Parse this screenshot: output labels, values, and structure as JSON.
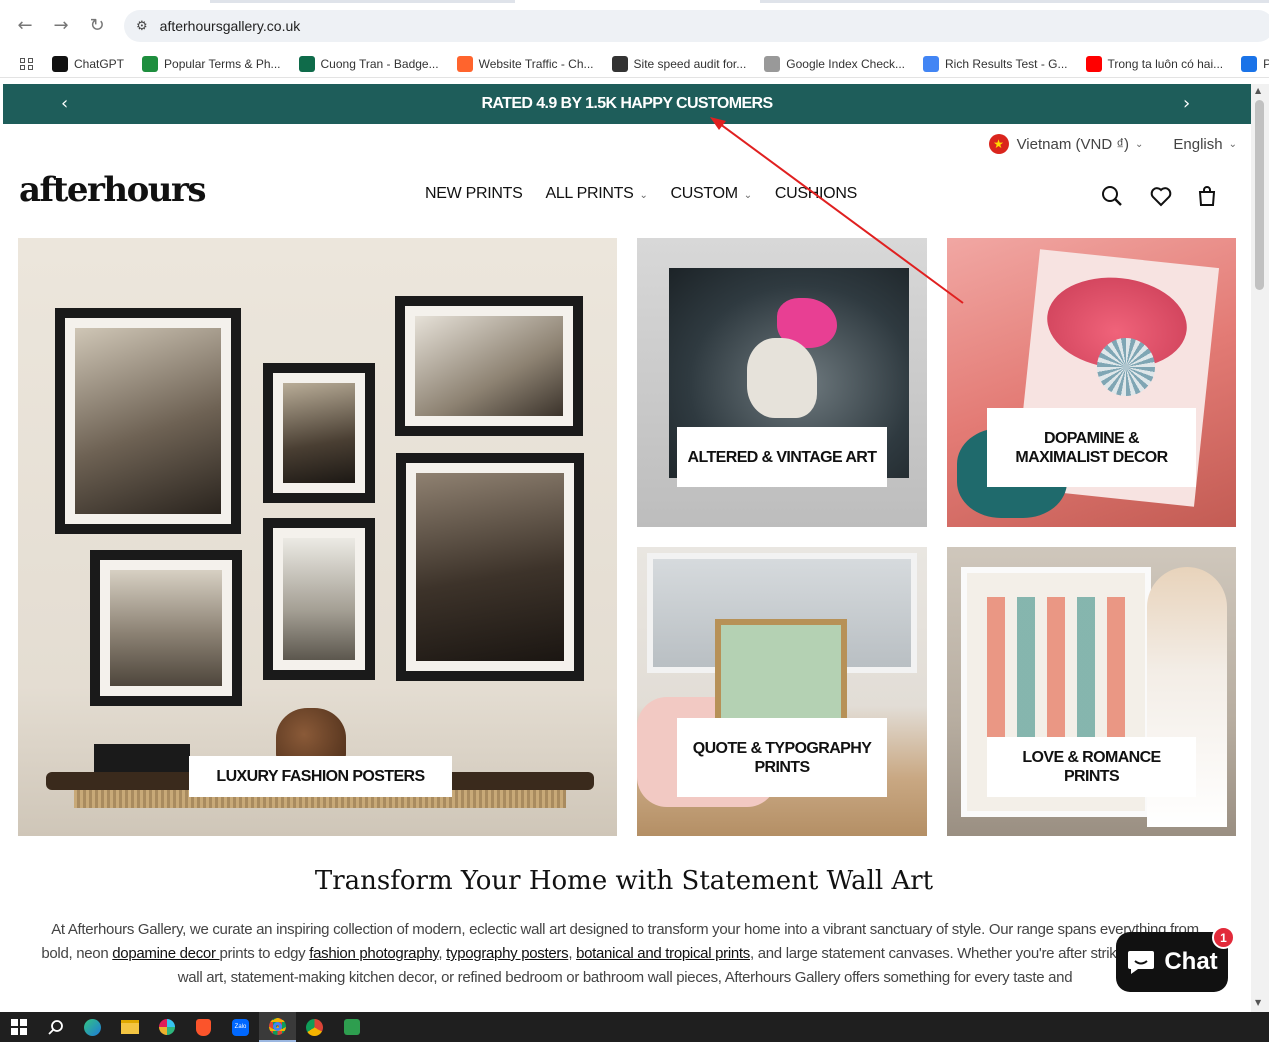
{
  "browser": {
    "url": "afterhoursgallery.co.uk",
    "bookmarks": [
      {
        "label": "ChatGPT",
        "icon": "chatgpt-icon",
        "color": "#111111"
      },
      {
        "label": "Popular Terms & Ph...",
        "icon": "sheets-icon",
        "color": "#1e8e3e"
      },
      {
        "label": "Cuong Tran - Badge...",
        "icon": "c-badge-icon",
        "color": "#0f6b4a"
      },
      {
        "label": "Website Traffic - Ch...",
        "icon": "semrush-icon",
        "color": "#ff642d"
      },
      {
        "label": "Site speed audit for...",
        "icon": "document-icon",
        "color": "#333333"
      },
      {
        "label": "Google Index Check...",
        "icon": "sst-icon",
        "color": "#999999"
      },
      {
        "label": "Rich Results Test - G...",
        "icon": "rich-results-icon",
        "color": "#4285f4"
      },
      {
        "label": "Trong ta luôn có hai...",
        "icon": "youtube-icon",
        "color": "#ff0000"
      },
      {
        "label": "Pag",
        "icon": "pagespeed-icon",
        "color": "#1a73e8"
      }
    ]
  },
  "announcement": {
    "text": "RATED 4.9 BY 1.5K HAPPY CUSTOMERS",
    "bg_color": "#1e5d5a"
  },
  "locale": {
    "country": "Vietnam (VND ₫)",
    "language": "English"
  },
  "header": {
    "logo": "afterhours",
    "nav": [
      {
        "label": "NEW PRINTS",
        "has_dropdown": false
      },
      {
        "label": "ALL PRINTS",
        "has_dropdown": true
      },
      {
        "label": "CUSTOM",
        "has_dropdown": true
      },
      {
        "label": "CUSHIONS",
        "has_dropdown": false
      }
    ]
  },
  "collections": [
    {
      "label": "LUXURY FASHION POSTERS"
    },
    {
      "label": "ALTERED & VINTAGE ART"
    },
    {
      "label": "DOPAMINE & MAXIMALIST DECOR"
    },
    {
      "label": "QUOTE & TYPOGRAPHY PRINTS"
    },
    {
      "label": "LOVE & ROMANCE PRINTS"
    }
  ],
  "section": {
    "heading": "Transform Your Home with Statement Wall Art",
    "p1": "At Afterhours Gallery, we curate an inspiring collection of modern, eclectic wall art designed to transform your home into a vibrant sanctuary of style. Our range spans everything from bold, neon ",
    "link1": "dopamine decor ",
    "p2": "prints to edgy ",
    "link2": "fashion photography",
    "p3": ", ",
    "link3": "typography posters",
    "p4": ", ",
    "link4": "botanical and tropical prints",
    "p5": ", and large statement canvases. Whether you're after striking living room wall art, statement-making kitchen decor, or refined bedroom or bathroom wall pieces, Afterhours Gallery offers something for every taste and"
  },
  "chat": {
    "label": "Chat",
    "badge": "1"
  },
  "taskbar_apps": [
    "windows-start-icon",
    "search-icon",
    "edge-icon",
    "file-explorer-icon",
    "slack-icon",
    "brave-icon",
    "zalo-icon",
    "chrome-icon",
    "chrome-profile-icon",
    "app-icon"
  ]
}
